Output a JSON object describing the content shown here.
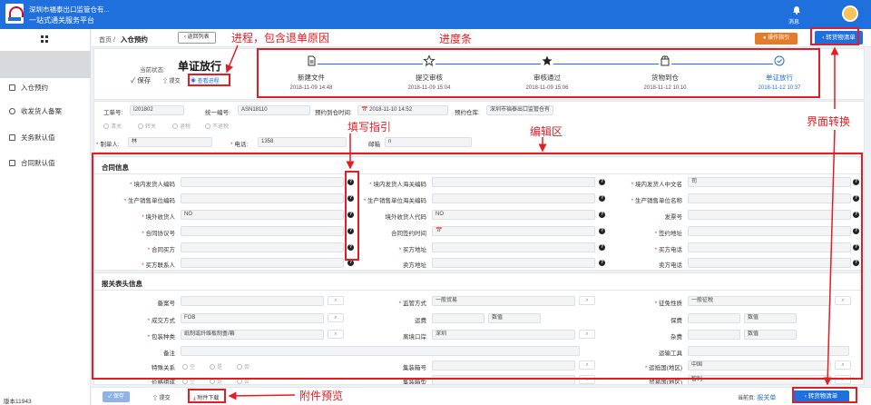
{
  "header": {
    "brand_line1": "深圳市福泰出口监管仓有...",
    "brand_line2": "一站式通关服务平台",
    "bell_label": "消息"
  },
  "sidebar": {
    "items": [
      {
        "label": "入仓预约",
        "icon": "clipboard-icon"
      },
      {
        "label": "收发货人备案",
        "icon": "gear-icon"
      },
      {
        "label": "关务默认值",
        "icon": "document-icon"
      },
      {
        "label": "合同默认值",
        "icon": "document-icon"
      }
    ],
    "version": "版本11943"
  },
  "breadcrumb": {
    "home": "首页",
    "current": "入仓预约",
    "back_label": "返回列表",
    "guide_label": "操作指引",
    "transfer_label": "转货物清单"
  },
  "status": {
    "label": "当前状态:",
    "value": "单证放行",
    "save_label": "保存",
    "submit_label": "提交",
    "progress_link": "查看进程"
  },
  "steps": [
    {
      "title": "新建文件",
      "time": "2018-11-09 14:48",
      "icon": "document-icon"
    },
    {
      "title": "提交审核",
      "time": "2018-11-09 15:04",
      "icon": "star-outline-icon"
    },
    {
      "title": "审核通过",
      "time": "2018-11-09 15:06",
      "icon": "star-filled-icon"
    },
    {
      "title": "货物到仓",
      "time": "2018-11-12 10:10",
      "icon": "box-icon"
    },
    {
      "title": "单证放行",
      "time": "2018-11-12 10:37",
      "icon": "check-circle-icon"
    }
  ],
  "form_top": {
    "work_no_label": "工单号:",
    "work_no_value": "I201802",
    "unified_no_label": "统一编号:",
    "unified_no_value": "ASN18110",
    "appt_time_label": "预约到仓时间:",
    "appt_time_value": "2018-11-10 14:52",
    "warehouse_label": "预约仓库:",
    "warehouse_value": "深圳市福泰出口监管仓有",
    "radios": [
      "清关",
      "转关",
      "退税",
      "不退税"
    ],
    "creator_label": "制单人:",
    "creator_value": "林",
    "phone_label": "电话:",
    "phone_value": "1358",
    "email_label": "邮箱",
    "email_value": "n"
  },
  "contract": {
    "title": "合同信息",
    "col1": [
      {
        "label": "境内发货人编码",
        "required": true,
        "value": ""
      },
      {
        "label": "生产销售单位编码",
        "required": true,
        "value": ""
      },
      {
        "label": "境外收货人",
        "required": true,
        "value": "NO"
      },
      {
        "label": "合同协议号",
        "required": true,
        "value": ""
      },
      {
        "label": "合同买方",
        "required": true,
        "value": ""
      },
      {
        "label": "买方联系人",
        "required": true,
        "value": ""
      }
    ],
    "col2": [
      {
        "label": "境内发货人海关编码",
        "required": true,
        "value": ""
      },
      {
        "label": "生产销售单位海关编码",
        "required": true,
        "value": ""
      },
      {
        "label": "境外收货人代码",
        "required": false,
        "value": "NO"
      },
      {
        "label": "合同签约时间",
        "required": false,
        "value": "📅"
      },
      {
        "label": "买方地址",
        "required": true,
        "value": ""
      },
      {
        "label": "卖方地址",
        "required": false,
        "value": ""
      }
    ],
    "col3": [
      {
        "label": "境内发货人中文名",
        "required": true,
        "value": "司"
      },
      {
        "label": "生产销售单位名称",
        "required": true,
        "value": ""
      },
      {
        "label": "发票号",
        "required": false,
        "value": ""
      },
      {
        "label": "签约地址",
        "required": true,
        "value": ""
      },
      {
        "label": "买方电话",
        "required": true,
        "value": ""
      },
      {
        "label": "卖方电话",
        "required": false,
        "value": ""
      }
    ]
  },
  "declaration": {
    "title": "报关表头信息",
    "row1": [
      {
        "label": "备案号",
        "required": false,
        "value": ""
      },
      {
        "label": "监管方式",
        "required": true,
        "value": "一般贸易"
      },
      {
        "label": "征免性质",
        "required": true,
        "value": "一般征税"
      }
    ],
    "row2": [
      {
        "label": "成交方式",
        "required": true,
        "value": "FOB"
      },
      {
        "label": "运费",
        "required": false,
        "value": "",
        "extra": "数值"
      },
      {
        "label": "保费",
        "required": false,
        "value": "",
        "extra": "数值"
      }
    ],
    "row3": [
      {
        "label": "包装种类",
        "required": true,
        "value": "纸制或纤维板制盒/箱"
      },
      {
        "label": "离境口岸",
        "required": false,
        "value": "深圳"
      },
      {
        "label": "杂费",
        "required": false,
        "value": "",
        "extra": "数值"
      }
    ],
    "row4_label": "备注",
    "row4_right_label": "运输工具",
    "row5": [
      {
        "label": "特殊关系",
        "radios": [
          "空",
          "是",
          "否"
        ]
      },
      {
        "label": "集装箱号",
        "required": false,
        "value": ""
      },
      {
        "label": "运抵国(地区)",
        "required": true,
        "value": "中国"
      }
    ],
    "row6": [
      {
        "label": "价格组成",
        "radios": [
          "空",
          "是",
          "否"
        ]
      },
      {
        "label": "集装箱型",
        "required": false,
        "value": ""
      },
      {
        "label": "贸易国(地区)",
        "required": false,
        "value": "智利"
      }
    ]
  },
  "footer": {
    "save_label": "保存",
    "submit_label": "提交",
    "attach_label": "附件下载",
    "page_label": "当前页:",
    "page_value": "报关单",
    "transfer_label": "转货物清单"
  },
  "annotations": {
    "progress": "进程，包含退单原因",
    "progress_bar": "进度条",
    "fill_guide": "填写指引",
    "edit_area": "编辑区",
    "switch": "界面转换",
    "attach_preview": "附件预览"
  },
  "colors": {
    "brand_blue": "#1f6fdd",
    "guide_orange": "#e47b2a",
    "annotation_red": "#e51c23"
  }
}
